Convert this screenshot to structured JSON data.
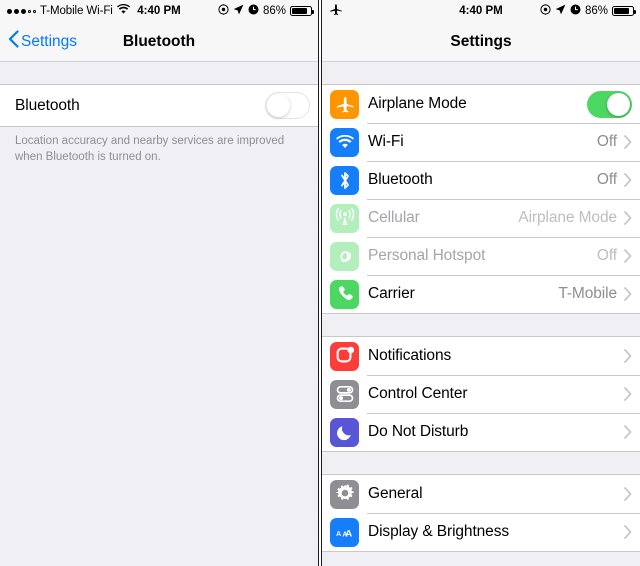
{
  "left": {
    "statusbar": {
      "signal_filled": 3,
      "signal_empty": 2,
      "carrier": "T-Mobile Wi-Fi",
      "wifi_icon": "wifi-icon",
      "time": "4:40 PM",
      "battery_percent": "86%",
      "icons": [
        "rotation-lock-icon",
        "location-arrow-icon",
        "alarm-clock-icon"
      ]
    },
    "nav": {
      "back_label": "Settings",
      "back_icon": "chevron-left-icon",
      "title": "Bluetooth"
    },
    "bluetooth_row": {
      "label": "Bluetooth",
      "toggle_state": "off"
    },
    "footer_note": "Location accuracy and nearby services are improved when Bluetooth is turned on."
  },
  "right": {
    "statusbar": {
      "airplane_icon": "airplane-icon",
      "time": "4:40 PM",
      "battery_percent": "86%",
      "icons": [
        "rotation-lock-icon",
        "location-arrow-icon",
        "alarm-clock-icon"
      ]
    },
    "nav": {
      "title": "Settings"
    },
    "groups": [
      {
        "rows": [
          {
            "label": "Airplane Mode",
            "icon": "airplane-icon",
            "icon_color": "#FF9500",
            "control": "toggle",
            "toggle_state": "on",
            "disabled": false
          },
          {
            "label": "Wi-Fi",
            "icon": "wifi-icon",
            "icon_color": "#147EFB",
            "value": "Off",
            "control": "chevron",
            "disabled": false
          },
          {
            "label": "Bluetooth",
            "icon": "bluetooth-icon",
            "icon_color": "#147EFB",
            "value": "Off",
            "control": "chevron",
            "disabled": false
          },
          {
            "label": "Cellular",
            "icon": "cellular-antenna-icon",
            "icon_color": "#4CD763",
            "value": "Airplane Mode",
            "control": "chevron",
            "disabled": true
          },
          {
            "label": "Personal Hotspot",
            "icon": "hotspot-link-icon",
            "icon_color": "#4CD763",
            "value": "Off",
            "control": "chevron",
            "disabled": true
          },
          {
            "label": "Carrier",
            "icon": "phone-handset-icon",
            "icon_color": "#4CD763",
            "value": "T-Mobile",
            "control": "chevron",
            "disabled": false
          }
        ]
      },
      {
        "rows": [
          {
            "label": "Notifications",
            "icon": "notifications-icon",
            "icon_color": "#FC3D39",
            "control": "chevron",
            "disabled": false
          },
          {
            "label": "Control Center",
            "icon": "control-center-icon",
            "icon_color": "#8E8E93",
            "control": "chevron",
            "disabled": false
          },
          {
            "label": "Do Not Disturb",
            "icon": "moon-icon",
            "icon_color": "#5856D6",
            "control": "chevron",
            "disabled": false
          }
        ]
      },
      {
        "rows": [
          {
            "label": "General",
            "icon": "gear-icon",
            "icon_color": "#8E8E93",
            "control": "chevron",
            "disabled": false
          },
          {
            "label": "Display & Brightness",
            "icon": "display-brightness-icon",
            "icon_color": "#147EFB",
            "control": "chevron",
            "disabled": false
          }
        ]
      }
    ]
  }
}
